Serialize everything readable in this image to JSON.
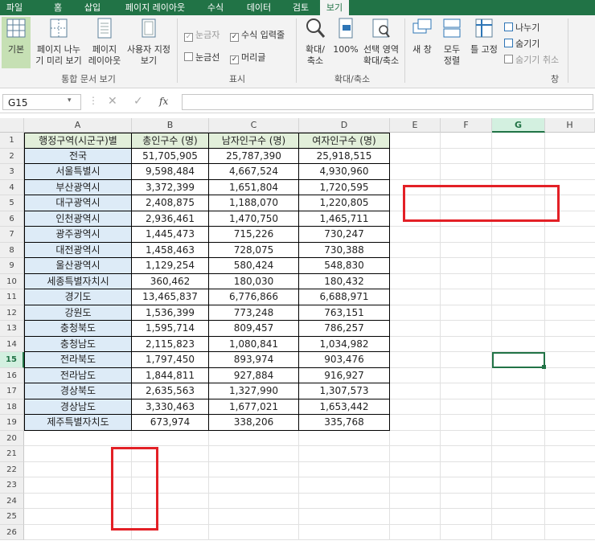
{
  "tabs": [
    "파일",
    "홈",
    "삽입",
    "페이지 레이아웃",
    "수식",
    "데이터",
    "검토",
    "보기"
  ],
  "ribbon": {
    "btn_normal": "기본",
    "btn_pagebreak": "페이지 나누\n기 미리 보기",
    "btn_pagelayout": "페이지\n레이아웃",
    "btn_custom": "사용자 지정\n보기",
    "group_views": "통합 문서 보기",
    "chk_ruler": "눈금자",
    "chk_formulabar": "수식 입력줄",
    "chk_gridlines": "눈금선",
    "chk_headings": "머리글",
    "group_show": "표시",
    "btn_zoom": "확대/\n축소",
    "btn_100": "100%",
    "btn_zoomsel": "선택 영역\n확대/축소",
    "group_zoom": "확대/축소",
    "btn_newwin": "새 창",
    "btn_arrange": "모두\n정렬",
    "btn_freeze": "틀 고정",
    "btn_split": "나누기",
    "btn_hide": "숨기기",
    "btn_unhide": "숨기기 취소",
    "group_window": "창"
  },
  "formula": {
    "namebox": "G15",
    "fx": "fx",
    "value": ""
  },
  "columns": [
    "A",
    "B",
    "C",
    "D",
    "E",
    "F",
    "G",
    "H"
  ],
  "selected_col": "G",
  "selected_row": 15,
  "headers": [
    "행정구역(시군구)별",
    "총인구수 (명)",
    "남자인구수 (명)",
    "여자인구수 (명)"
  ],
  "rows": [
    [
      "전국",
      "51,705,905",
      "25,787,390",
      "25,918,515"
    ],
    [
      "서울특별시",
      "9,598,484",
      "4,667,524",
      "4,930,960"
    ],
    [
      "부산광역시",
      "3,372,399",
      "1,651,804",
      "1,720,595"
    ],
    [
      "대구광역시",
      "2,408,875",
      "1,188,070",
      "1,220,805"
    ],
    [
      "인천광역시",
      "2,936,461",
      "1,470,750",
      "1,465,711"
    ],
    [
      "광주광역시",
      "1,445,473",
      "715,226",
      "730,247"
    ],
    [
      "대전광역시",
      "1,458,463",
      "728,075",
      "730,388"
    ],
    [
      "울산광역시",
      "1,129,254",
      "580,424",
      "548,830"
    ],
    [
      "세종특별자치시",
      "360,462",
      "180,030",
      "180,432"
    ],
    [
      "경기도",
      "13,465,837",
      "6,776,866",
      "6,688,971"
    ],
    [
      "강원도",
      "1,536,399",
      "773,248",
      "763,151"
    ],
    [
      "충청북도",
      "1,595,714",
      "809,457",
      "786,257"
    ],
    [
      "충청남도",
      "2,115,823",
      "1,080,841",
      "1,034,982"
    ],
    [
      "전라북도",
      "1,797,450",
      "893,974",
      "903,476"
    ],
    [
      "전라남도",
      "1,844,811",
      "927,884",
      "916,927"
    ],
    [
      "경상북도",
      "2,635,563",
      "1,327,990",
      "1,307,573"
    ],
    [
      "경상남도",
      "3,330,463",
      "1,677,021",
      "1,653,442"
    ],
    [
      "제주특별자치도",
      "673,974",
      "338,206",
      "335,768"
    ]
  ],
  "row_numbers": [
    1,
    2,
    3,
    4,
    5,
    6,
    7,
    8,
    9,
    10,
    11,
    12,
    13,
    14,
    15,
    16,
    17,
    18,
    19,
    20,
    21,
    22,
    23,
    24,
    25,
    26
  ],
  "colors": {
    "accent": "#217346",
    "header_fill": "#e2efda",
    "region_fill": "#ddebf7",
    "highlight": "#e32026"
  }
}
